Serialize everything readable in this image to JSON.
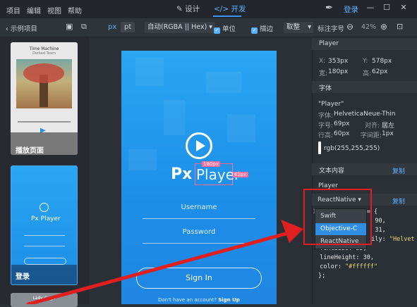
{
  "menu": [
    "项目",
    "编辑",
    "视图",
    "帮助"
  ],
  "modes": {
    "design": "设计",
    "dev": "开发"
  },
  "login": "登录",
  "toolbar": {
    "back_label": "示例项目",
    "unit_px": "px",
    "unit_pt": "pt",
    "color_format": "自动(RGBA || Hex)",
    "check_unit": "单位",
    "check_stroke": "描边",
    "round_label": "取整",
    "mark_label": "标注字号",
    "zoom": "42%"
  },
  "thumbs": {
    "music_title": "Time Machine",
    "music_subtitle": "Dorked Team",
    "label_play": "播放页面",
    "label_login": "登录",
    "label_lady": "Lady Gaga"
  },
  "phone": {
    "brand_px": "Px",
    "brand_player": "Player",
    "width_badge": "180px",
    "height_badge": "62px",
    "username": "Username",
    "password": "Password",
    "signin": "Sign In",
    "no_account": "Don't have an account?",
    "signup": "Sign Up"
  },
  "right": {
    "layer_name": "Player",
    "x_label": "X:",
    "x_val": "353px",
    "y_label": "Y:",
    "y_val": "578px",
    "w_label": "宽:",
    "w_val": "180px",
    "h_label": "高:",
    "h_val": "62px",
    "font_section": "字体",
    "font_name": "\"Player\"",
    "font_face_label": "字体:",
    "font_face": "HelveticaNeue-Thin",
    "font_size_label": "字号:",
    "font_size": "69px",
    "align_label": "对齐:",
    "align": "居左",
    "line_label": "行高:",
    "line": "60px",
    "spacing_label": "字间距:",
    "spacing": "1px",
    "color_value": "rgb(255,255,255)",
    "text_section": "文本内容",
    "copy": "复制",
    "text_content": "Player",
    "lang_selected": "ReactNative",
    "copy2": "复制"
  },
  "dropdown": [
    "Swift",
    "Objective-C",
    "ReactNative"
  ],
  "code": {
    "l1a": "1 ",
    "l1b": "er = {",
    "l2": "   90,",
    "l3": "   31,",
    "l4a": "  ily: ",
    "l4b": "\"Helvet",
    "l5": "  fontSize: 35,",
    "l6": "  lineHeight: 30,",
    "l7a": "  color: ",
    "l7b": "\"#ffffff\"",
    "l8": "};"
  },
  "colors": {
    "accent": "#3b93ff",
    "annotation": "#e02020"
  }
}
